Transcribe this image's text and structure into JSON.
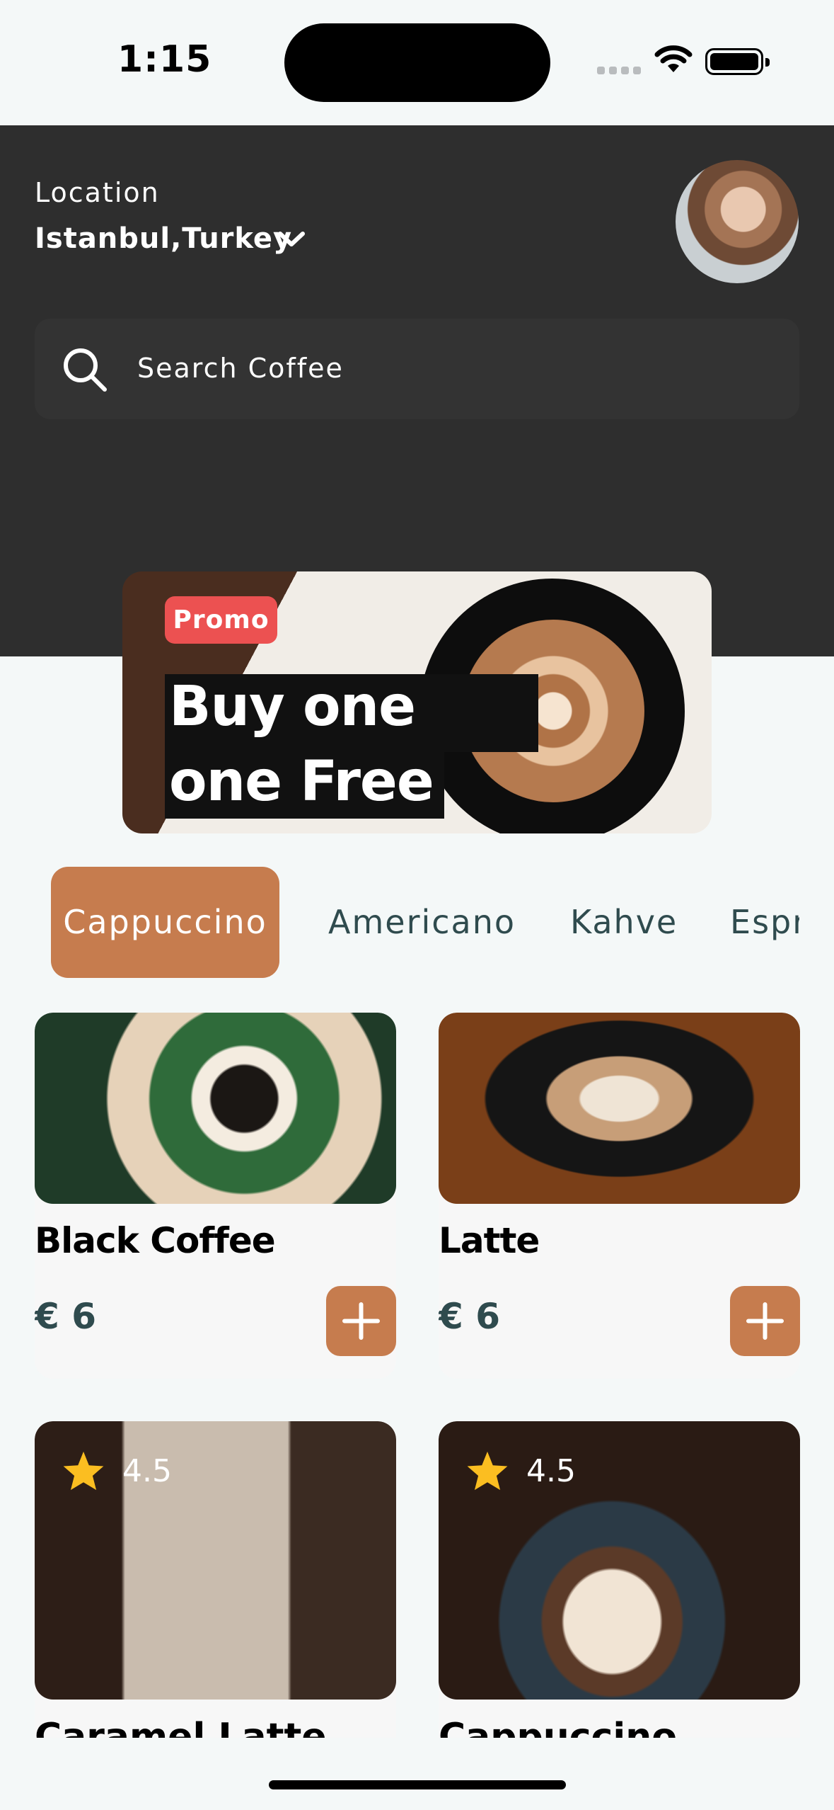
{
  "status_bar": {
    "time": "1:15"
  },
  "header": {
    "location_label": "Location",
    "location_value": "Istanbul,Turkey",
    "search_placeholder": "Search Coffee"
  },
  "promo": {
    "badge": "Promo",
    "line1": "Buy one get",
    "line2": "one Free"
  },
  "tabs": [
    {
      "label": "Cappuccino",
      "active": true
    },
    {
      "label": "Americano"
    },
    {
      "label": "Kahve"
    },
    {
      "label": "Espr"
    }
  ],
  "products": [
    {
      "name": "Black Coffee",
      "price": "€ 6"
    },
    {
      "name": "Latte",
      "price": "€ 6"
    },
    {
      "name": "Caramel Latte",
      "rating": "4.5"
    },
    {
      "name": "Cappuccino",
      "rating": "4.5"
    }
  ],
  "colors": {
    "accent": "#C67C4E",
    "header_bg": "#2E2E2E",
    "promo_badge": "#EC5151",
    "price_text": "#2F4B4E",
    "star": "#FBBE21"
  }
}
